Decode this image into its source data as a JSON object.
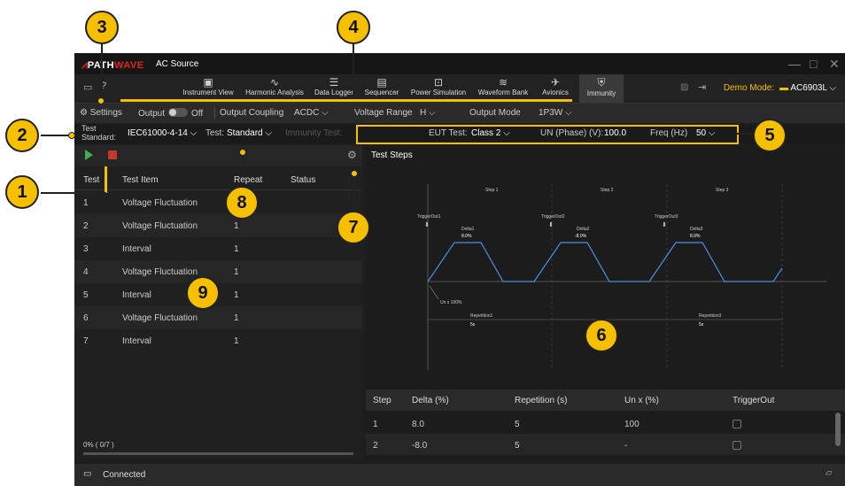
{
  "app": {
    "brand_path": "PATH",
    "brand_wave": "WAVE",
    "title": "AC Source",
    "window_controls": {
      "minimize": "—",
      "maximize": "□",
      "close": "✕"
    }
  },
  "ribbon": {
    "items": [
      {
        "label": "Instrument View",
        "icon": "instrument-view-icon"
      },
      {
        "label": "Harmonic Analysis",
        "icon": "harmonic-analysis-icon"
      },
      {
        "label": "Data Logger",
        "icon": "data-logger-icon"
      },
      {
        "label": "Sequencer",
        "icon": "sequencer-icon"
      },
      {
        "label": "Power Simulation",
        "icon": "power-simulation-icon"
      },
      {
        "label": "Waveform Bank",
        "icon": "waveform-bank-icon"
      },
      {
        "label": "Avionics",
        "icon": "avionics-icon"
      },
      {
        "label": "Immunity",
        "icon": "immunity-icon"
      }
    ],
    "demo_mode_label": "Demo Mode:",
    "device": "AC6903L"
  },
  "toolbar": {
    "settings": "Settings",
    "output_label": "Output",
    "output_state": "Off",
    "coupling_label": "Output Coupling",
    "coupling_value": "ACDC",
    "range_label": "Voltage Range",
    "range_value": "H",
    "mode_label": "Output Mode",
    "mode_value": "1P3W"
  },
  "standard_bar": {
    "test_standard_label_1": "Test",
    "test_standard_label_2": "Standard:",
    "test_standard_value": "IEC61000-4-14",
    "test_label": "Test:",
    "test_value": "Standard",
    "immunity_test_label": "Immunity Test:",
    "eut_label": "EUT Test:",
    "eut_value": "Class 2",
    "un_label": "UN (Phase) (V):",
    "un_value": "100.0",
    "freq_label": "Freq (Hz)",
    "freq_value": "50"
  },
  "test_table": {
    "headers": [
      "Test",
      "Test Item",
      "Repeat",
      "Status"
    ],
    "rows": [
      {
        "test": "1",
        "item": "Voltage Fluctuation",
        "repeat": "1",
        "status": ""
      },
      {
        "test": "2",
        "item": "Voltage Fluctuation",
        "repeat": "1",
        "status": ""
      },
      {
        "test": "3",
        "item": "Interval",
        "repeat": "1",
        "status": ""
      },
      {
        "test": "4",
        "item": "Voltage Fluctuation",
        "repeat": "1",
        "status": ""
      },
      {
        "test": "5",
        "item": "Interval",
        "repeat": "1",
        "status": ""
      },
      {
        "test": "6",
        "item": "Voltage Fluctuation",
        "repeat": "1",
        "status": ""
      },
      {
        "test": "7",
        "item": "Interval",
        "repeat": "1",
        "status": ""
      }
    ],
    "progress": "0% ( 0/7 )"
  },
  "test_steps": {
    "title": "Test Steps",
    "diagram": {
      "steps": [
        "Step 1",
        "Step 2",
        "Step 3"
      ],
      "triggers": [
        "TriggerOut1",
        "TriggerOut2",
        "TriggerOut3"
      ],
      "deltas": [
        "Delta1",
        "Delta2",
        "Delta3"
      ],
      "delta_values": [
        "8.0%",
        "-8.0%",
        "8.0%"
      ],
      "un_label": "Un x 100%",
      "repetitions": [
        "Repetition1",
        "Repetition3"
      ],
      "repetition_values": [
        "5s",
        "5s"
      ]
    },
    "headers": [
      "Step",
      "Delta (%)",
      "Repetition (s)",
      "Un x (%)",
      "TriggerOut"
    ],
    "rows": [
      {
        "step": "1",
        "delta": "8.0",
        "repetition": "5",
        "un": "100"
      },
      {
        "step": "2",
        "delta": "-8.0",
        "repetition": "5",
        "un": "-"
      }
    ]
  },
  "status_bar": {
    "connection": "Connected"
  },
  "callouts": [
    "1",
    "2",
    "3",
    "4",
    "5",
    "6",
    "7",
    "8",
    "9"
  ],
  "colors": {
    "callout": "#f6c000",
    "accent_red": "#e0241a",
    "play_green": "#3fb24a",
    "stop_red": "#c0392b",
    "waveform_blue": "#4a90e2"
  }
}
